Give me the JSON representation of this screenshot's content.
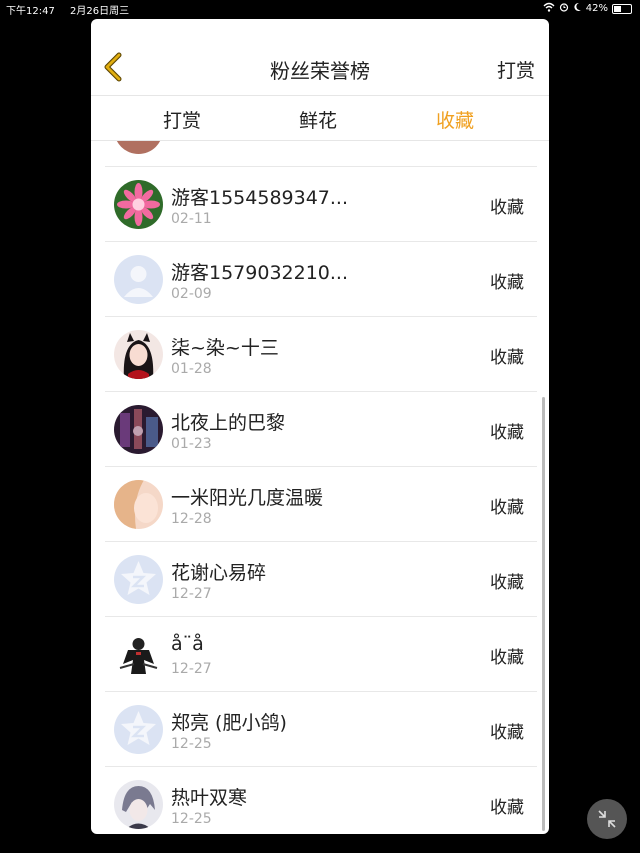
{
  "status": {
    "time": "下午12:47",
    "date": "2月26日周三",
    "battery": "42%",
    "battery_level": 0.42
  },
  "nav": {
    "title": "粉丝荣誉榜",
    "right_label": "打赏"
  },
  "tabs": [
    {
      "label": "打赏"
    },
    {
      "label": "鲜花"
    },
    {
      "label": "收藏"
    }
  ],
  "active_tab": "收藏",
  "items": [
    {
      "name": "游客1554589347...",
      "date": "02-11",
      "action": "收藏",
      "avatar": "pink-flower-avatar"
    },
    {
      "name": "游客1579032210...",
      "date": "02-09",
      "action": "收藏",
      "avatar": "default-person-avatar"
    },
    {
      "name": "柒~染~十三",
      "date": "01-28",
      "action": "收藏",
      "avatar": "anime-girl-avatar"
    },
    {
      "name": "北夜上的巴黎",
      "date": "01-23",
      "action": "收藏",
      "avatar": "dark-photo-avatar"
    },
    {
      "name": "一米阳光几度温暖",
      "date": "12-28",
      "action": "收藏",
      "avatar": "blonde-photo-avatar"
    },
    {
      "name": "花谢心易碎",
      "date": "12-27",
      "action": "收藏",
      "avatar": "qzone-star-avatar"
    },
    {
      "name": "å¨å",
      "date": "12-27",
      "action": "收藏",
      "avatar": "anime-figure-avatar"
    },
    {
      "name": "郑亮 (肥小鸽)",
      "date": "12-25",
      "action": "收藏",
      "avatar": "qzone-star-avatar"
    },
    {
      "name": "热叶双寒",
      "date": "12-25",
      "action": "收藏",
      "avatar": "anime-boy-avatar"
    }
  ],
  "colors": {
    "accent": "#f0a020",
    "back_arrow": "#d6a200",
    "default_avatar_bg": "#dbe3f3"
  }
}
